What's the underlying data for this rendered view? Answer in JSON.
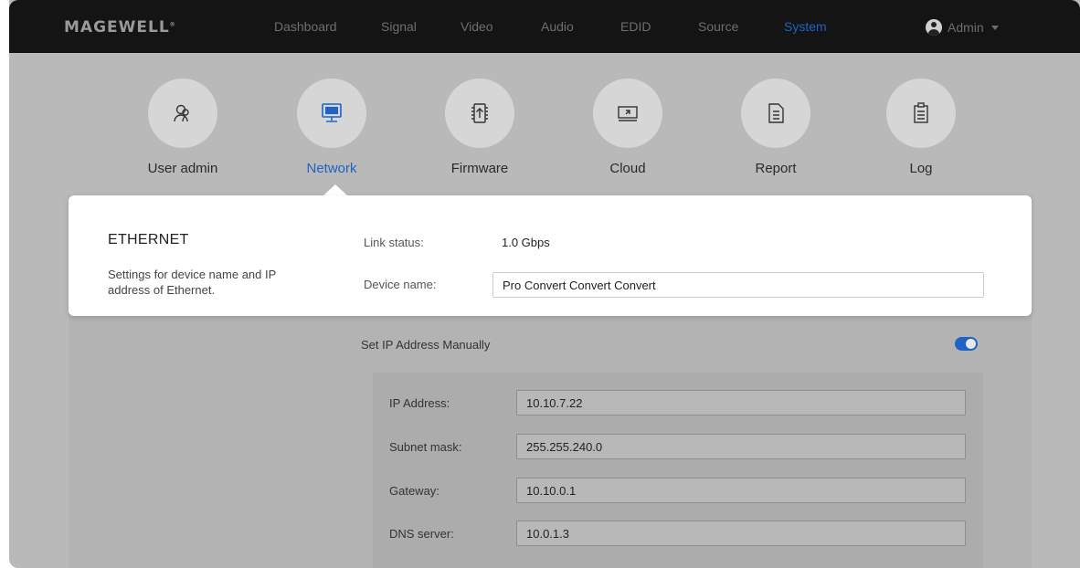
{
  "brand": {
    "logo_text": "MAGEWELL",
    "logo_mark": "®"
  },
  "nav": {
    "items": [
      {
        "label": "Dashboard"
      },
      {
        "label": "Signal"
      },
      {
        "label": "Video"
      },
      {
        "label": "Audio"
      },
      {
        "label": "EDID"
      },
      {
        "label": "Source"
      },
      {
        "label": "System",
        "active": true
      }
    ],
    "user": "Admin"
  },
  "system_tiles": [
    {
      "label": "User admin",
      "icon": "user-admin-icon"
    },
    {
      "label": "Network",
      "icon": "monitor-icon",
      "active": true
    },
    {
      "label": "Firmware",
      "icon": "chip-upload-icon"
    },
    {
      "label": "Cloud",
      "icon": "cloud-screen-icon"
    },
    {
      "label": "Report",
      "icon": "report-icon"
    },
    {
      "label": "Log",
      "icon": "clipboard-icon"
    }
  ],
  "ethernet": {
    "title": "ETHERNET",
    "description": "Settings for device name and IP address of Ethernet.",
    "link_status_label": "Link status:",
    "link_status_value": "1.0 Gbps",
    "device_name_label": "Device name:",
    "device_name_value": "Pro Convert Convert Convert"
  },
  "ip_settings": {
    "manual_label": "Set IP Address Manually",
    "manual_enabled": true,
    "fields": [
      {
        "label": "IP Address:",
        "value": "10.10.7.22"
      },
      {
        "label": "Subnet mask:",
        "value": "255.255.240.0"
      },
      {
        "label": "Gateway:",
        "value": "10.10.0.1"
      },
      {
        "label": "DNS server:",
        "value": "10.0.1.3"
      }
    ]
  },
  "colors": {
    "accent": "#1f63c4",
    "topbar": "#141414",
    "overlay": "#b9b9b9"
  }
}
